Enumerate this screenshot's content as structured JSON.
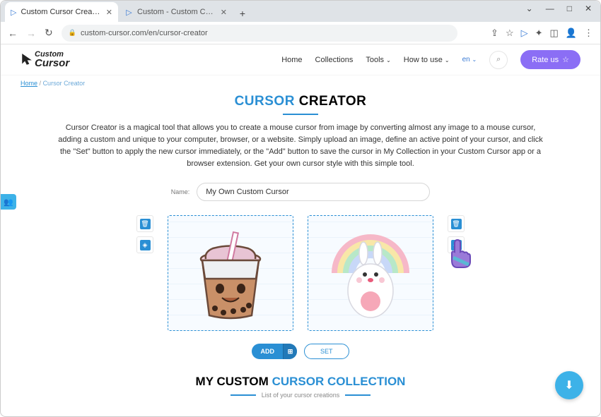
{
  "window": {
    "controls": {
      "min": "—",
      "max": "□",
      "close": "✕",
      "chevron": "⌄"
    }
  },
  "tabs": [
    {
      "title": "Custom Cursor Creator - Custom",
      "active": true
    },
    {
      "title": "Custom - Custom Cursor",
      "active": false
    }
  ],
  "address": {
    "url": "custom-cursor.com/en/cursor-creator",
    "back": "←",
    "forward": "→",
    "reload": "↻",
    "lock": "🔒"
  },
  "header": {
    "logo_top": "Custom",
    "logo_bottom": "Cursor",
    "nav": {
      "home": "Home",
      "collections": "Collections",
      "tools": "Tools",
      "howto": "How to use",
      "lang": "en",
      "search_icon": "⌕",
      "rate": "Rate us",
      "star": "☆"
    }
  },
  "breadcrumb": {
    "home": "Home",
    "sep": "/",
    "current": "Cursor Creator"
  },
  "page": {
    "title_blue": "CURSOR",
    "title_black": "CREATOR",
    "description": "Cursor Creator is a magical tool that allows you to create a mouse cursor from image by converting almost any image to a mouse cursor, adding a custom and unique to your computer, browser, or a website. Simply upload an image, define an active point of your cursor, and click the \"Set\" button to apply the new cursor immediately, or the \"Add\" button to save the cursor in My Collection in your Custom Cursor app or a browser extension. Get your own cursor style with this simple tool.",
    "name_label": "Name:",
    "name_value": "My Own Custom Cursor",
    "tools": {
      "delete": "🗑",
      "erase": "◈"
    },
    "actions": {
      "add": "ADD",
      "set": "SET",
      "windows": "⊞"
    },
    "collection_black": "MY CUSTOM",
    "collection_blue": "CURSOR COLLECTION",
    "collection_sub": "List of your cursor creations"
  },
  "fab": "⬇",
  "side_float": "👥"
}
